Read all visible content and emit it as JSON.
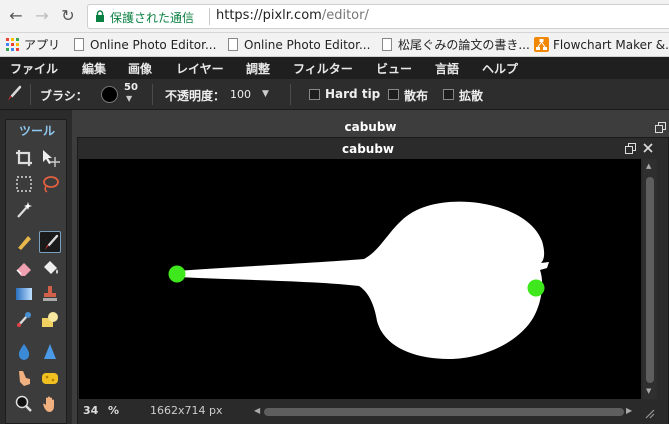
{
  "browser": {
    "secure_label": "保護された通信",
    "url_scheme_host": "https://pixlr.com",
    "url_path": "/editor/",
    "bookmarks": [
      {
        "label": "アプリ"
      },
      {
        "label": "Online Photo Editor..."
      },
      {
        "label": "Online Photo Editor..."
      },
      {
        "label": "松尾ぐみの論文の書き..."
      },
      {
        "label": "Flowchart Maker &..."
      }
    ]
  },
  "menu": {
    "items": [
      "ファイル",
      "編集",
      "画像",
      "レイヤー",
      "調整",
      "フィルター",
      "ビュー",
      "言語",
      "ヘルプ"
    ]
  },
  "options": {
    "brush_label": "ブラシ：",
    "brush_size": "50",
    "opacity_label": "不透明度：",
    "opacity_value": "100",
    "hard_tip_label": "Hard tip",
    "scatter_label": "散布",
    "diffuse_label": "拡散"
  },
  "tools": {
    "title": "ツール",
    "active_tool": "brush-tool"
  },
  "document": {
    "outer_title": "cabubw",
    "title": "cabubw",
    "zoom": "34",
    "zoom_unit": "%",
    "dimensions": "1662x714 px"
  },
  "colors": {
    "accent_blue": "#8ec8f0",
    "marker_green": "#3ee81c",
    "secure_green": "#0b8043"
  }
}
